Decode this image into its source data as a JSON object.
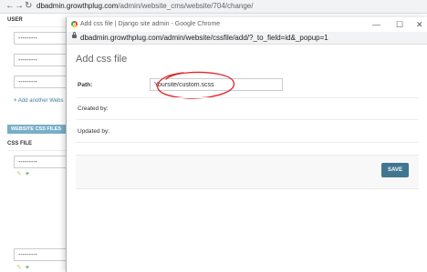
{
  "background": {
    "url_host": "dbadmin.growthplug.com",
    "url_path": "/admin/website_cms/website/704/change/",
    "user_column_header": "USER",
    "select_placeholder": "---------",
    "add_another_label": "Add another Webs",
    "section_title": "WEBSITE CSS FILES",
    "css_file_column_header": "CSS FILE"
  },
  "popup": {
    "window_title": "Add css file | Django site admin - Google Chrome",
    "url": "dbadmin.growthplug.com/admin/website/cssfile/add/?_to_field=id&_popup=1",
    "page_title": "Add css file",
    "fields": {
      "path_label": "Path:",
      "path_value": "Yoursite/custom.scss",
      "created_by_label": "Created by:",
      "updated_by_label": "Updated by:"
    },
    "save_label": "SAVE",
    "annotation_color": "#e0262b",
    "accent_color": "#417690"
  }
}
